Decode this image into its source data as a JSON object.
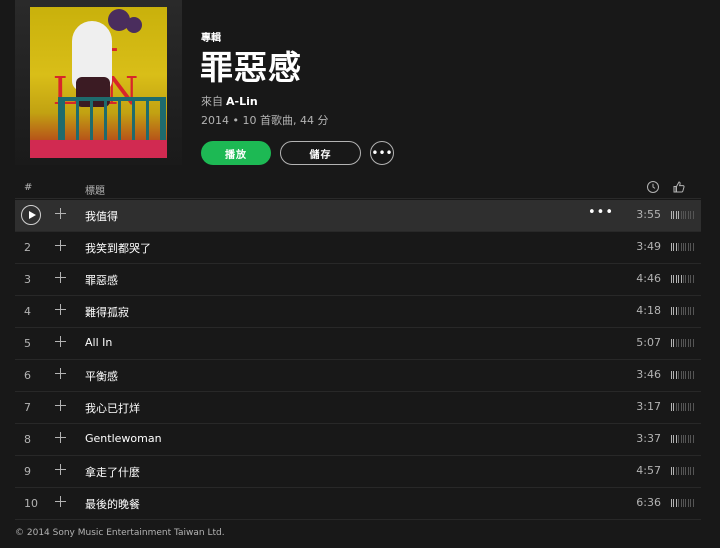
{
  "album": {
    "type_label": "專輯",
    "title": "罪惡感",
    "by_prefix": "來自",
    "artist": "A-Lin",
    "meta": "2014 • 10 首歌曲, 44 分",
    "cover_text": "A-LIN"
  },
  "actions": {
    "play_label": "播放",
    "save_label": "儲存",
    "more_label": "•••"
  },
  "track_header": {
    "number": "#",
    "title": "標題",
    "duration_icon": "clock-icon",
    "popularity_icon": "thumbs-up-icon"
  },
  "tracks": [
    {
      "number": "1",
      "title": "我值得",
      "duration": "3:55",
      "popularity": 0.4,
      "active": true
    },
    {
      "number": "2",
      "title": "我笑到都哭了",
      "duration": "3:49",
      "popularity": 0.3,
      "active": false
    },
    {
      "number": "3",
      "title": "罪惡感",
      "duration": "4:46",
      "popularity": 0.5,
      "active": false
    },
    {
      "number": "4",
      "title": "難得孤寂",
      "duration": "4:18",
      "popularity": 0.3,
      "active": false
    },
    {
      "number": "5",
      "title": "All In",
      "duration": "5:07",
      "popularity": 0.2,
      "active": false
    },
    {
      "number": "6",
      "title": "平衡感",
      "duration": "3:46",
      "popularity": 0.3,
      "active": false
    },
    {
      "number": "7",
      "title": "我心已打烊",
      "duration": "3:17",
      "popularity": 0.2,
      "active": false
    },
    {
      "number": "8",
      "title": "Gentlewoman",
      "duration": "3:37",
      "popularity": 0.3,
      "active": false
    },
    {
      "number": "9",
      "title": "拿走了什麼",
      "duration": "4:57",
      "popularity": 0.2,
      "active": false
    },
    {
      "number": "10",
      "title": "最後的晚餐",
      "duration": "6:36",
      "popularity": 0.3,
      "active": false
    }
  ],
  "row_more_label": "•••",
  "footer": "© 2014 Sony Music Entertainment Taiwan Ltd.",
  "colors": {
    "accent": "#1db954",
    "background": "#181818",
    "active_row": "#2f2f2f"
  }
}
